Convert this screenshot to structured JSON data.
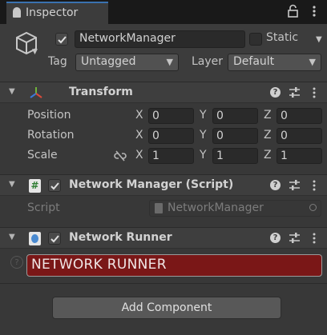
{
  "tab": {
    "label": "Inspector"
  },
  "header": {
    "object_name": "NetworkManager",
    "static_label": "Static",
    "tag_label": "Tag",
    "tag_value": "Untagged",
    "layer_label": "Layer",
    "layer_value": "Default"
  },
  "transform": {
    "title": "Transform",
    "rows": [
      {
        "label": "Position",
        "x": "0",
        "y": "0",
        "z": "0"
      },
      {
        "label": "Rotation",
        "x": "0",
        "y": "0",
        "z": "0"
      },
      {
        "label": "Scale",
        "x": "1",
        "y": "1",
        "z": "1"
      }
    ],
    "axis": {
      "x": "X",
      "y": "Y",
      "z": "Z"
    }
  },
  "network_manager": {
    "title": "Network Manager (Script)",
    "script_label": "Script",
    "script_value": "NetworkManager"
  },
  "network_runner": {
    "title": "Network Runner",
    "banner": "NETWORK RUNNER"
  },
  "add_component_label": "Add Component",
  "colors": {
    "banner_red": "#7a1717",
    "tab_accent": "#3a72b0"
  }
}
